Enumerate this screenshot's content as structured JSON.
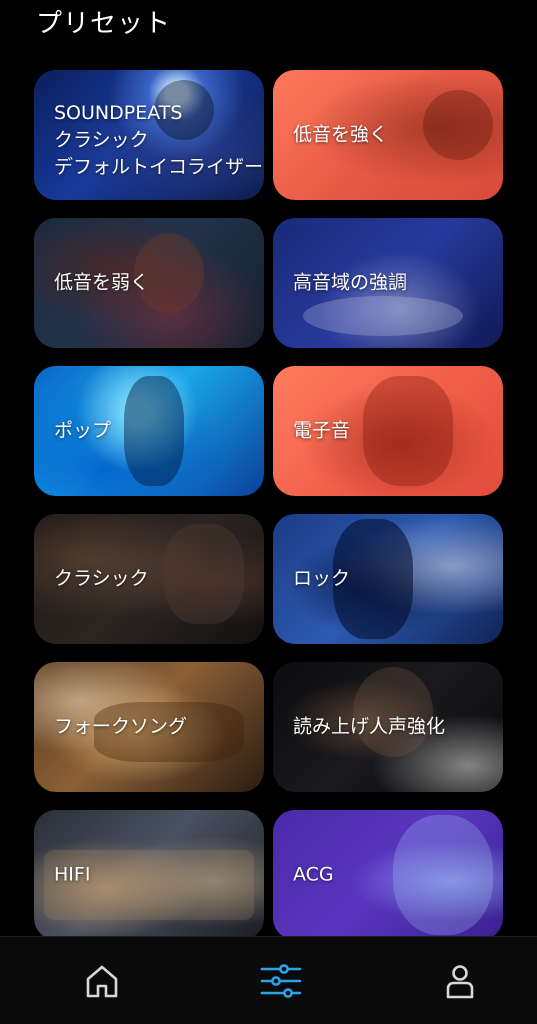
{
  "header": {
    "title": "プリセット"
  },
  "presets": [
    {
      "id": "classic-default",
      "lines": [
        "SOUNDPEATS",
        "クラシック",
        "デフォルトイコライザー"
      ]
    },
    {
      "id": "bass-boost",
      "lines": [
        "低音を強く"
      ]
    },
    {
      "id": "bass-reduce",
      "lines": [
        "低音を弱く"
      ]
    },
    {
      "id": "treble",
      "lines": [
        "高音域の強調"
      ]
    },
    {
      "id": "pop",
      "lines": [
        "ポップ"
      ]
    },
    {
      "id": "electronic",
      "lines": [
        "電子音"
      ]
    },
    {
      "id": "classic",
      "lines": [
        "クラシック"
      ]
    },
    {
      "id": "rock",
      "lines": [
        "ロック"
      ]
    },
    {
      "id": "folk",
      "lines": [
        "フォークソング"
      ]
    },
    {
      "id": "vocal",
      "lines": [
        "読み上げ人声強化"
      ]
    },
    {
      "id": "hifi",
      "lines": [
        "HIFI"
      ]
    },
    {
      "id": "acg",
      "lines": [
        "ACG"
      ]
    }
  ],
  "tabbar": {
    "items": [
      {
        "icon": "home-icon",
        "active": false
      },
      {
        "icon": "equalizer-icon",
        "active": true
      },
      {
        "icon": "profile-icon",
        "active": false
      }
    ],
    "active_color": "#2aa3e8",
    "inactive_color": "#d8d8d8"
  }
}
